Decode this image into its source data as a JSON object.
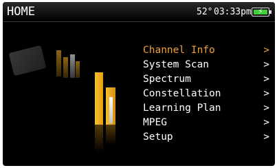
{
  "header": {
    "title": "HOME",
    "temperature": "52°",
    "time": "03:33pm",
    "battery_icon": "battery-charging-icon"
  },
  "menu": {
    "selected_index": 0,
    "arrow": ">",
    "items": [
      {
        "label": "Channel Info"
      },
      {
        "label": "System Scan"
      },
      {
        "label": "Spectrum"
      },
      {
        "label": "Constellation"
      },
      {
        "label": "Learning Plan"
      },
      {
        "label": "MPEG"
      },
      {
        "label": "Setup"
      }
    ]
  },
  "colors": {
    "selected": "#f0a030",
    "text": "#ffffff",
    "battery": "#3fcf36"
  }
}
